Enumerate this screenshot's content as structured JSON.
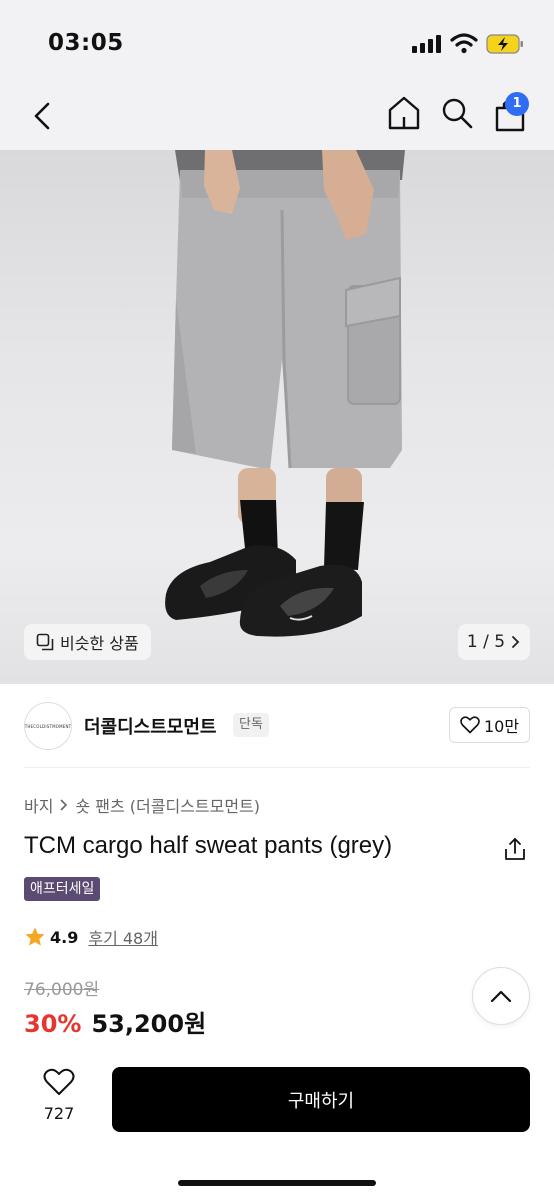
{
  "status_bar": {
    "time": "03:05"
  },
  "nav": {
    "cart_count": "1"
  },
  "gallery": {
    "similar_label": "비슷한 상품",
    "pager": "1 / 5"
  },
  "brand": {
    "logo_text": "THECOLDISTMOMENT",
    "name": "더콜디스트모먼트",
    "tag": "단독",
    "likes": "10만"
  },
  "product": {
    "breadcrumb": [
      "바지",
      "숏 팬츠 (더콜디스트모먼트)"
    ],
    "title": "TCM cargo half sweat pants (grey)",
    "sale_badge": "애프터세일",
    "rating": "4.9",
    "review_link": "후기 48개",
    "original_price": "76,000원",
    "discount": "30%",
    "price": "53,200원"
  },
  "bottom_bar": {
    "like_count": "727",
    "buy_label": "구매하기"
  },
  "colors": {
    "accent": "#2f6df5",
    "discount": "#e8342e",
    "badge": "#5b4a72",
    "star": "#f5a623"
  }
}
